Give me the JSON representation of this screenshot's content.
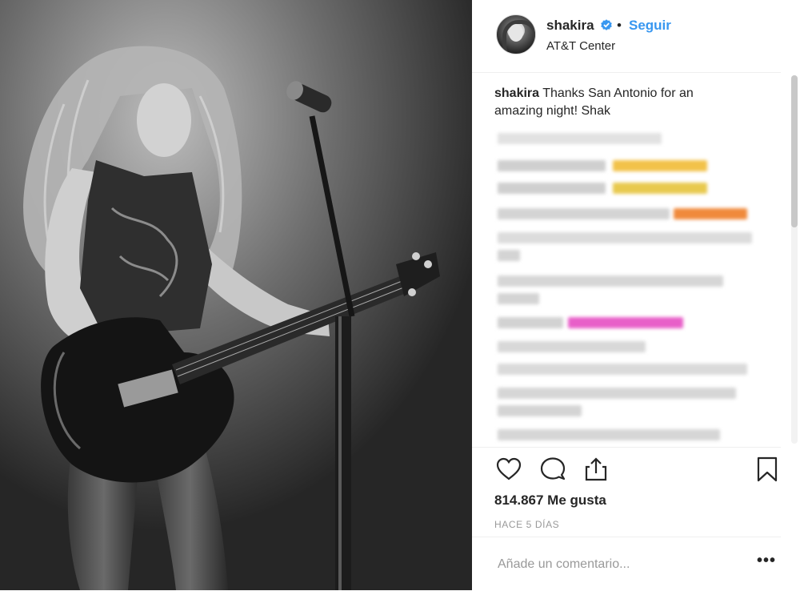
{
  "post": {
    "username": "shakira",
    "follow_label": "Seguir",
    "separator": "•",
    "location": "AT&T Center",
    "caption_user": "shakira",
    "caption_text": " Thanks San Antonio for an amazing night! Shak",
    "likes": "814.867 Me gusta",
    "time": "HACE 5 DÍAS",
    "comment_placeholder": "Añade un comentario...",
    "more_label": "•••"
  },
  "colors": {
    "accent": "#3897f0",
    "verified": "#3897f0",
    "emoji_yellow": "#f2c24a",
    "emoji_orange": "#f08a3c",
    "emoji_pink": "#e85fc8"
  },
  "icons": {
    "like": "heart-icon",
    "comment": "comment-bubble-icon",
    "share": "share-icon",
    "save": "bookmark-icon",
    "verified": "verified-badge-icon"
  }
}
